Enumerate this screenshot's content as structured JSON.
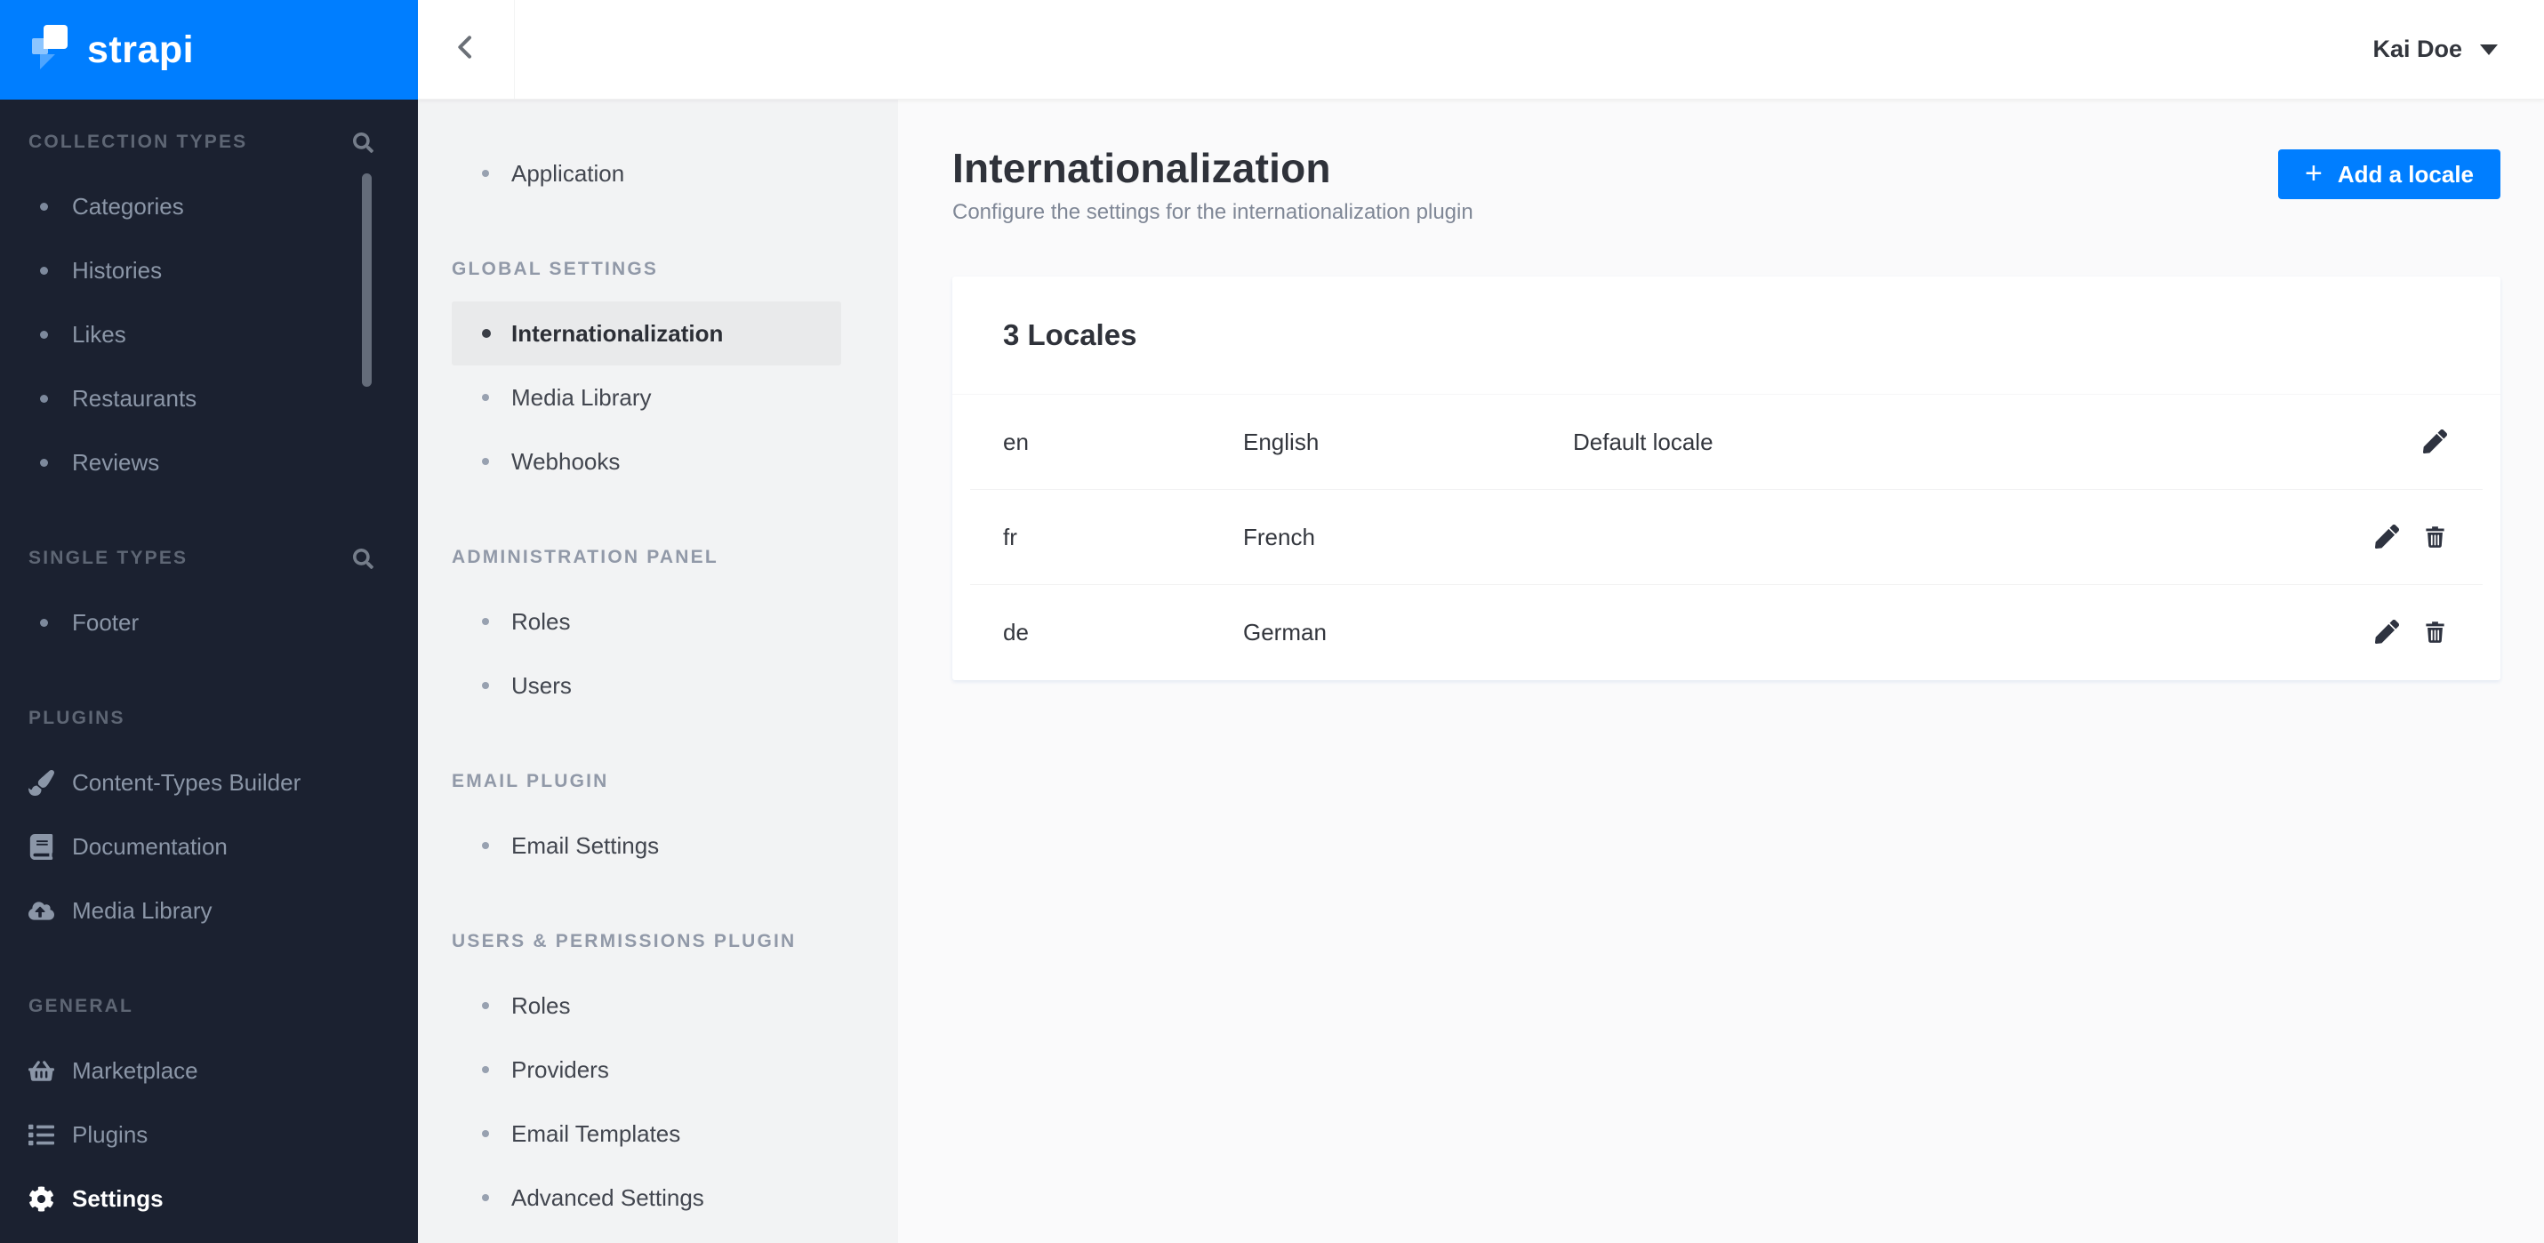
{
  "brand": {
    "logo_text": "strapi",
    "logo_icon": "strapi-logo-icon",
    "accent_color": "#007eff",
    "sidebar_color": "#1b2130"
  },
  "dark_sidebar": {
    "sections": [
      {
        "label": "COLLECTION TYPES",
        "search_icon": "search-icon",
        "items": [
          {
            "label": "Categories"
          },
          {
            "label": "Histories"
          },
          {
            "label": "Likes"
          },
          {
            "label": "Restaurants"
          },
          {
            "label": "Reviews"
          }
        ]
      },
      {
        "label": "SINGLE TYPES",
        "search_icon": "search-icon",
        "items": [
          {
            "label": "Footer"
          }
        ]
      },
      {
        "label": "PLUGINS",
        "items": [
          {
            "label": "Content-Types Builder",
            "icon": "paint-brush-icon"
          },
          {
            "label": "Documentation",
            "icon": "book-icon"
          },
          {
            "label": "Media Library",
            "icon": "cloud-upload-icon"
          }
        ]
      },
      {
        "label": "GENERAL",
        "items": [
          {
            "label": "Marketplace",
            "icon": "basket-icon"
          },
          {
            "label": "Plugins",
            "icon": "list-icon"
          },
          {
            "label": "Settings",
            "icon": "gear-icon",
            "active": true
          }
        ]
      }
    ]
  },
  "topbar": {
    "user_name": "Kai Doe",
    "back_icon": "chevron-left-icon",
    "user_caret_icon": "chevron-down-icon"
  },
  "settings_nav": {
    "groups": [
      {
        "header": "",
        "items": [
          {
            "label": "Application"
          }
        ]
      },
      {
        "header": "GLOBAL SETTINGS",
        "items": [
          {
            "label": "Internationalization",
            "active": true
          },
          {
            "label": "Media Library"
          },
          {
            "label": "Webhooks"
          }
        ]
      },
      {
        "header": "ADMINISTRATION PANEL",
        "items": [
          {
            "label": "Roles"
          },
          {
            "label": "Users"
          }
        ]
      },
      {
        "header": "EMAIL PLUGIN",
        "items": [
          {
            "label": "Email Settings"
          }
        ]
      },
      {
        "header": "USERS & PERMISSIONS PLUGIN",
        "items": [
          {
            "label": "Roles"
          },
          {
            "label": "Providers"
          },
          {
            "label": "Email Templates"
          },
          {
            "label": "Advanced Settings"
          }
        ]
      }
    ]
  },
  "page": {
    "title": "Internationalization",
    "subtitle": "Configure the settings for the internationalization plugin",
    "add_button_icon": "+",
    "add_button_label": "Add a locale"
  },
  "locales": {
    "count_title": "3 Locales",
    "edit_icon": "pencil-icon",
    "delete_icon": "trash-icon",
    "rows": [
      {
        "code": "en",
        "name": "English",
        "default_label": "Default locale",
        "deletable": false
      },
      {
        "code": "fr",
        "name": "French",
        "default_label": "",
        "deletable": true
      },
      {
        "code": "de",
        "name": "German",
        "default_label": "",
        "deletable": true
      }
    ]
  }
}
